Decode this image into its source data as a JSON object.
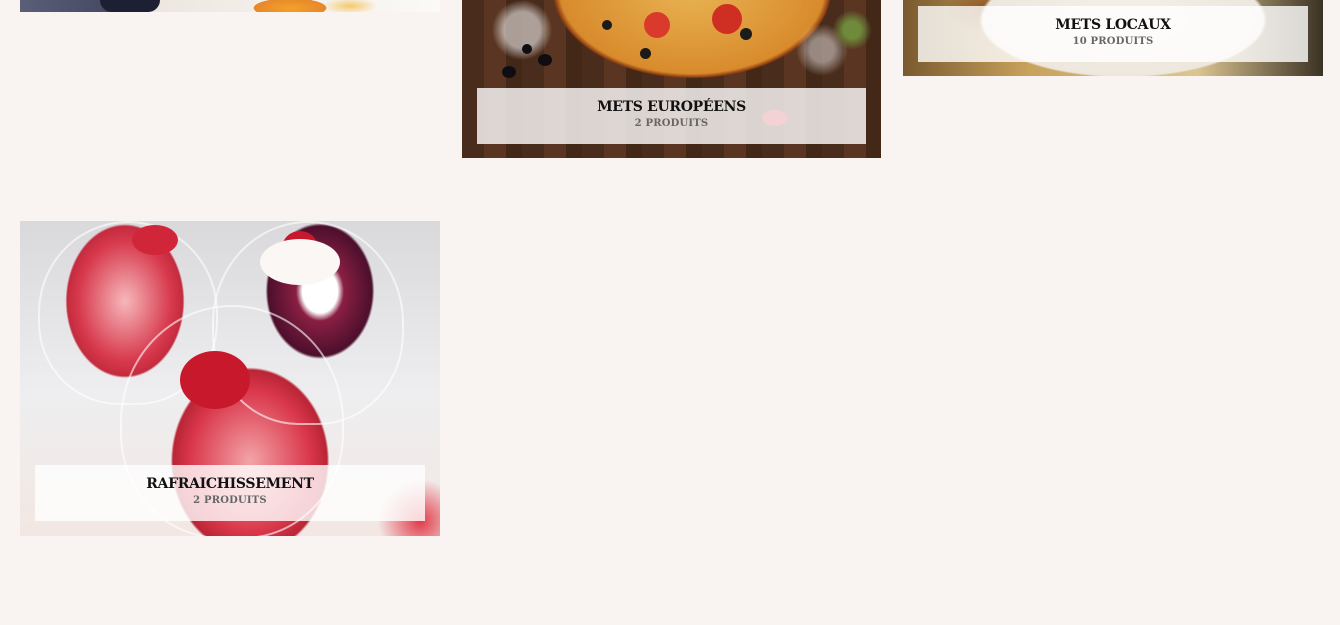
{
  "categories": [
    {
      "id": "c1",
      "title": "",
      "count": ""
    },
    {
      "id": "c2",
      "title": "METS EUROPÉENS",
      "count": "2 PRODUITS"
    },
    {
      "id": "c3",
      "title": "METS LOCAUX",
      "count": "10 PRODUITS"
    },
    {
      "id": "c4",
      "title": "RAFRAICHISSEMENT",
      "count": "2 PRODUITS"
    }
  ],
  "colors": {
    "page_background": "#f9f4f2",
    "label_background": "rgba(255,255,255,0.80)",
    "title_text": "#111111",
    "count_text": "#666666"
  }
}
